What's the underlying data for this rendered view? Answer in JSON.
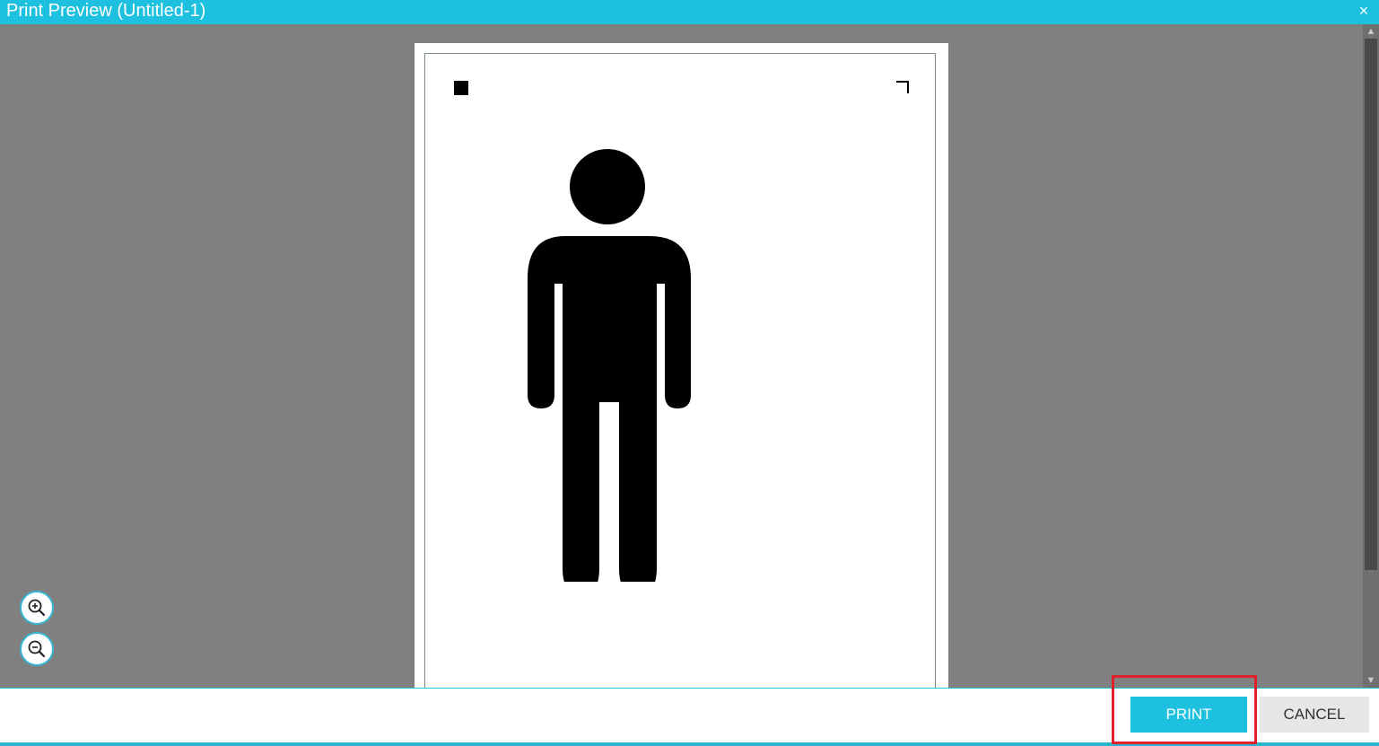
{
  "window": {
    "title": "Print Preview (Untitled-1)",
    "close_label": "×"
  },
  "preview": {
    "figure_icon": "standing-person-icon"
  },
  "zoom": {
    "in_icon": "zoom-in-icon",
    "out_icon": "zoom-out-icon"
  },
  "scrollbar": {
    "up_arrow": "▲",
    "down_arrow": "▼"
  },
  "actions": {
    "print_label": "PRINT",
    "cancel_label": "CANCEL"
  },
  "colors": {
    "accent": "#1ec0e0",
    "highlight": "#e0202a",
    "preview_bg": "#808080"
  }
}
